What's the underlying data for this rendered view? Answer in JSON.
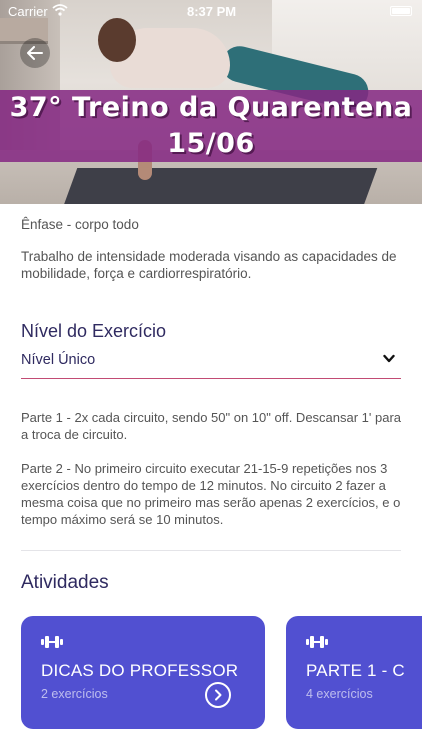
{
  "status_bar": {
    "carrier": "Carrier",
    "time": "8:37 PM"
  },
  "hero": {
    "title_line1": "37° Treino da Quarentena",
    "title_line2": "15/06"
  },
  "content": {
    "emphasis": "Ênfase - corpo todo",
    "description": "Trabalho de intensidade moderada visando as capacidades de mobilidade, força e cardiorrespiratório.",
    "level_label": "Nível do Exercício",
    "level_value": "Nível Único",
    "part1": "Parte 1 - 2x cada circuito, sendo 50\" on 10\" off. Descansar 1' para a troca de circuito.",
    "part2": "Parte 2 - No primeiro circuito executar 21-15-9 repetições nos 3 exercícios dentro do tempo de 12 minutos. No circuito 2 fazer a mesma coisa que no primeiro mas serão apenas 2 exercícios, e o tempo máximo será se 10 minutos.",
    "activities_label": "Atividades"
  },
  "cards": [
    {
      "title": "DICAS DO PROFESSOR",
      "subtitle": "2 exercícios",
      "icon": "dumbbell-icon"
    },
    {
      "title": "PARTE 1 - C",
      "subtitle": "4 exercícios",
      "icon": "dumbbell-icon"
    }
  ],
  "colors": {
    "accent": "#5150d1",
    "banner": "#852882",
    "heading": "#2f2a60",
    "select_underline": "#c24b74"
  }
}
